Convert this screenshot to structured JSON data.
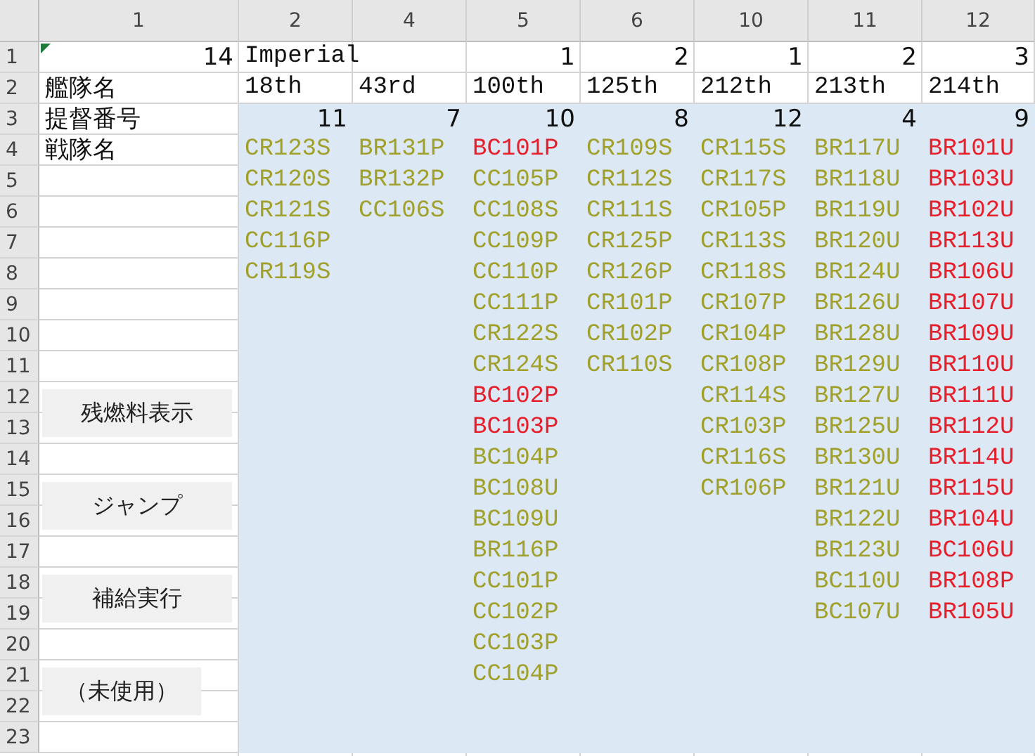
{
  "column_headers": [
    "1",
    "2",
    "4",
    "5",
    "6",
    "10",
    "11",
    "12"
  ],
  "row_headers": [
    "1",
    "2",
    "3",
    "4",
    "5",
    "6",
    "7",
    "8",
    "9",
    "10",
    "11",
    "12",
    "13",
    "14",
    "15",
    "16",
    "17",
    "18",
    "19",
    "20",
    "21",
    "22",
    "23"
  ],
  "summary": {
    "count": "14",
    "labels": [
      "艦隊名",
      "提督番号",
      "戦隊名"
    ]
  },
  "title": "Imperial",
  "fleets": [
    {
      "name": "18th",
      "admiral": "11",
      "squadrons": [
        {
          "code": "CR123S",
          "color": "#a0a02a"
        },
        {
          "code": "CR120S",
          "color": "#a0a02a"
        },
        {
          "code": "CR121S",
          "color": "#a0a02a"
        },
        {
          "code": "CC116P",
          "color": "#a0a02a"
        },
        {
          "code": "CR119S",
          "color": "#a0a02a"
        }
      ]
    },
    {
      "name": "43rd",
      "admiral": "7",
      "squadrons": [
        {
          "code": "BR131P",
          "color": "#a0a02a"
        },
        {
          "code": "BR132P",
          "color": "#a0a02a"
        },
        {
          "code": "CC106S",
          "color": "#a0a02a"
        }
      ]
    },
    {
      "number": "1",
      "name": "100th",
      "admiral": "10",
      "squadrons": [
        {
          "code": "BC101P",
          "color": "#e61e2a"
        },
        {
          "code": "CC105P",
          "color": "#a0a02a"
        },
        {
          "code": "CC108S",
          "color": "#a0a02a"
        },
        {
          "code": "CC109P",
          "color": "#a0a02a"
        },
        {
          "code": "CC110P",
          "color": "#a0a02a"
        },
        {
          "code": "CC111P",
          "color": "#a0a02a"
        },
        {
          "code": "CR122S",
          "color": "#a0a02a"
        },
        {
          "code": "CR124S",
          "color": "#a0a02a"
        },
        {
          "code": "BC102P",
          "color": "#e61e2a"
        },
        {
          "code": "BC103P",
          "color": "#e61e2a"
        },
        {
          "code": "BC104P",
          "color": "#a0a02a"
        },
        {
          "code": "BC108U",
          "color": "#a0a02a"
        },
        {
          "code": "BC109U",
          "color": "#a0a02a"
        },
        {
          "code": "BR116P",
          "color": "#a0a02a"
        },
        {
          "code": "CC101P",
          "color": "#a0a02a"
        },
        {
          "code": "CC102P",
          "color": "#a0a02a"
        },
        {
          "code": "CC103P",
          "color": "#a0a02a"
        },
        {
          "code": "CC104P",
          "color": "#a0a02a"
        }
      ]
    },
    {
      "number": "2",
      "name": "125th",
      "admiral": "8",
      "squadrons": [
        {
          "code": "CR109S",
          "color": "#a0a02a"
        },
        {
          "code": "CR112S",
          "color": "#a0a02a"
        },
        {
          "code": "CR111S",
          "color": "#a0a02a"
        },
        {
          "code": "CR125P",
          "color": "#a0a02a"
        },
        {
          "code": "CR126P",
          "color": "#a0a02a"
        },
        {
          "code": "CR101P",
          "color": "#a0a02a"
        },
        {
          "code": "CR102P",
          "color": "#a0a02a"
        },
        {
          "code": "CR110S",
          "color": "#a0a02a"
        }
      ]
    },
    {
      "number": "1",
      "name": "212th",
      "admiral": "12",
      "squadrons": [
        {
          "code": "CR115S",
          "color": "#a0a02a"
        },
        {
          "code": "CR117S",
          "color": "#a0a02a"
        },
        {
          "code": "CR105P",
          "color": "#a0a02a"
        },
        {
          "code": "CR113S",
          "color": "#a0a02a"
        },
        {
          "code": "CR118S",
          "color": "#a0a02a"
        },
        {
          "code": "CR107P",
          "color": "#a0a02a"
        },
        {
          "code": "CR104P",
          "color": "#a0a02a"
        },
        {
          "code": "CR108P",
          "color": "#a0a02a"
        },
        {
          "code": "CR114S",
          "color": "#a0a02a"
        },
        {
          "code": "CR103P",
          "color": "#a0a02a"
        },
        {
          "code": "CR116S",
          "color": "#a0a02a"
        },
        {
          "code": "CR106P",
          "color": "#a0a02a"
        }
      ]
    },
    {
      "number": "2",
      "name": "213th",
      "admiral": "4",
      "squadrons": [
        {
          "code": "BR117U",
          "color": "#a0a02a"
        },
        {
          "code": "BR118U",
          "color": "#a0a02a"
        },
        {
          "code": "BR119U",
          "color": "#a0a02a"
        },
        {
          "code": "BR120U",
          "color": "#a0a02a"
        },
        {
          "code": "BR124U",
          "color": "#a0a02a"
        },
        {
          "code": "BR126U",
          "color": "#a0a02a"
        },
        {
          "code": "BR128U",
          "color": "#a0a02a"
        },
        {
          "code": "BR129U",
          "color": "#a0a02a"
        },
        {
          "code": "BR127U",
          "color": "#a0a02a"
        },
        {
          "code": "BR125U",
          "color": "#a0a02a"
        },
        {
          "code": "BR130U",
          "color": "#a0a02a"
        },
        {
          "code": "BR121U",
          "color": "#a0a02a"
        },
        {
          "code": "BR122U",
          "color": "#a0a02a"
        },
        {
          "code": "BR123U",
          "color": "#a0a02a"
        },
        {
          "code": "BC110U",
          "color": "#a0a02a"
        },
        {
          "code": "BC107U",
          "color": "#a0a02a"
        }
      ]
    },
    {
      "number": "3",
      "name": "214th",
      "admiral": "9",
      "squadrons": [
        {
          "code": "BR101U",
          "color": "#e61e2a"
        },
        {
          "code": "BR103U",
          "color": "#e61e2a"
        },
        {
          "code": "BR102U",
          "color": "#e61e2a"
        },
        {
          "code": "BR113U",
          "color": "#e61e2a"
        },
        {
          "code": "BR106U",
          "color": "#e61e2a"
        },
        {
          "code": "BR107U",
          "color": "#e61e2a"
        },
        {
          "code": "BR109U",
          "color": "#e61e2a"
        },
        {
          "code": "BR110U",
          "color": "#e61e2a"
        },
        {
          "code": "BR111U",
          "color": "#e61e2a"
        },
        {
          "code": "BR112U",
          "color": "#e61e2a"
        },
        {
          "code": "BR114U",
          "color": "#e61e2a"
        },
        {
          "code": "BR115U",
          "color": "#e61e2a"
        },
        {
          "code": "BR104U",
          "color": "#e61e2a"
        },
        {
          "code": "BC106U",
          "color": "#e61e2a"
        },
        {
          "code": "BR108P",
          "color": "#e61e2a"
        },
        {
          "code": "BR105U",
          "color": "#e61e2a"
        }
      ]
    }
  ],
  "buttons": [
    {
      "label": "残燃料表示"
    },
    {
      "label": "ジャンプ"
    },
    {
      "label": "補給実行"
    },
    {
      "label": "（未使用）"
    }
  ]
}
